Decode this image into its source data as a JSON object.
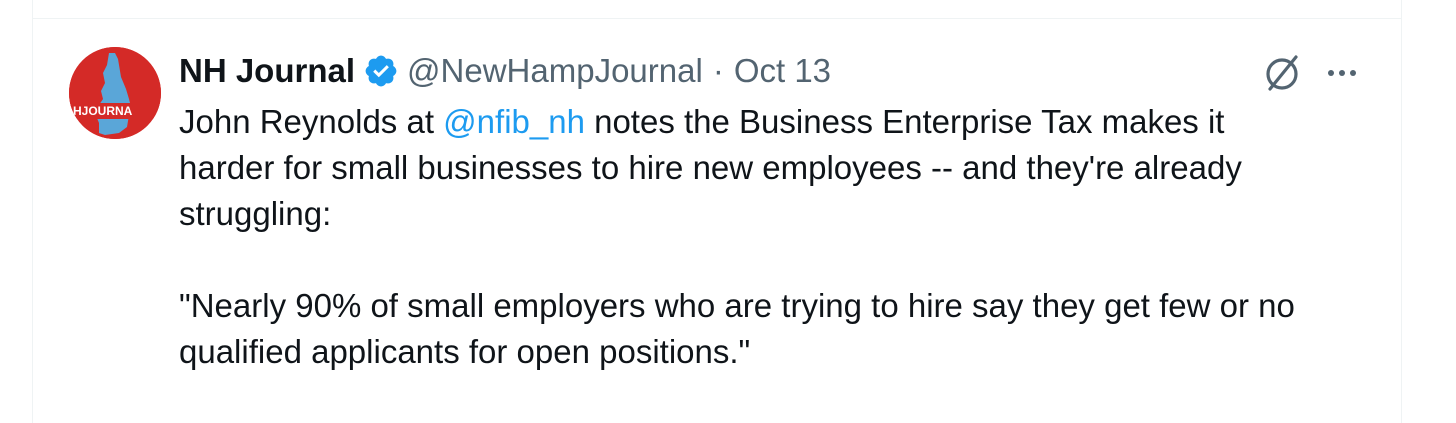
{
  "colors": {
    "text": "#0f1419",
    "secondary": "#536471",
    "link": "#1d9bf0",
    "verified": "#1d9bf0",
    "avatar_bg": "#d42a27"
  },
  "tweet": {
    "display_name": "NH Journal",
    "handle": "@NewHampJournal",
    "separator": "·",
    "time": "Oct 13",
    "avatar_text": "HJOURNA",
    "icons": {
      "verified": "verified-badge-icon",
      "grok": "grok-icon",
      "more": "more-options-icon"
    },
    "more_label": "···",
    "text": {
      "line1_pre": "John Reynolds at ",
      "mention": "@nfib_nh",
      "line1_post": " notes the Business Enterprise Tax makes it",
      "line2": "harder for small businesses to hire new employees -- and they're already",
      "line3": "struggling:",
      "line5": "\"Nearly 90% of small employers who are trying to hire say they get few or no",
      "line6": "qualified applicants for open positions.\""
    }
  }
}
